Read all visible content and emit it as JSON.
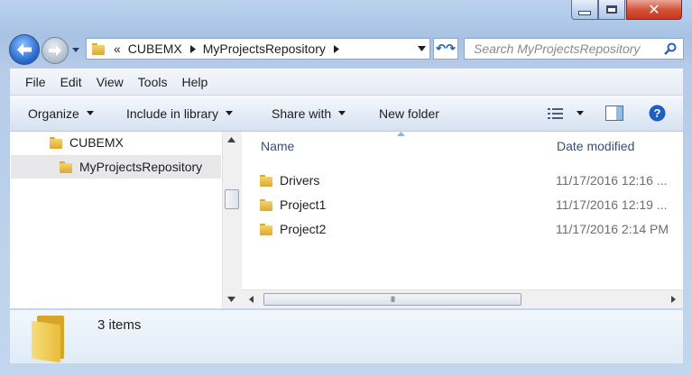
{
  "window": {
    "minimize_icon": "minimize-icon",
    "maximize_icon": "maximize-icon",
    "close_icon": "close-icon",
    "close_glyph": "✕"
  },
  "navigation": {
    "back_icon": "back-arrow-icon",
    "forward_icon": "forward-arrow-icon",
    "breadcrumb_overflow": "«",
    "breadcrumbs": [
      "CUBEMX",
      "MyProjectsRepository"
    ],
    "refresh_glyph": "↶↷",
    "search_placeholder": "Search MyProjectsRepository"
  },
  "menu": {
    "items": [
      "File",
      "Edit",
      "View",
      "Tools",
      "Help"
    ]
  },
  "toolbar": {
    "organize": "Organize",
    "include_in_library": "Include in library",
    "share_with": "Share with",
    "new_folder": "New folder",
    "help_glyph": "?"
  },
  "nav_tree": {
    "items": [
      {
        "label": "CUBEMX",
        "selected": false
      },
      {
        "label": "MyProjectsRepository",
        "selected": true
      }
    ]
  },
  "file_list": {
    "columns": [
      "Name",
      "Date modified"
    ],
    "rows": [
      {
        "name": "Drivers",
        "date": "11/17/2016 12:16 ..."
      },
      {
        "name": "Project1",
        "date": "11/17/2016 12:19 ..."
      },
      {
        "name": "Project2",
        "date": "11/17/2016 2:14 PM"
      }
    ],
    "scroll_grip": "III"
  },
  "details": {
    "count_text": "3 items"
  },
  "colors": {
    "accent": "#2e6fd1",
    "folder": "#e9bd3c",
    "close": "#d4543b"
  }
}
